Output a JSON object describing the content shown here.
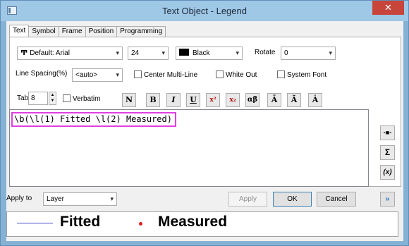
{
  "window": {
    "title": "Text Object - Legend",
    "close": "✕"
  },
  "tabs": [
    {
      "label": "Text"
    },
    {
      "label": "Symbol"
    },
    {
      "label": "Frame"
    },
    {
      "label": "Position"
    },
    {
      "label": "Programming"
    }
  ],
  "font": {
    "value": "Default: Arial",
    "glyph": "Ͳ"
  },
  "size": {
    "value": "24"
  },
  "color": {
    "value": "Black",
    "swatch": "#000000"
  },
  "rotate": {
    "label": "Rotate",
    "value": "0"
  },
  "line_spacing": {
    "label": "Line Spacing(%)",
    "value": "<auto>"
  },
  "checkboxes": {
    "center_multiline": "Center Multi-Line",
    "white_out": "White Out",
    "system_font": "System Font",
    "verbatim": "Verbatim"
  },
  "tab_field": {
    "label": "Tab",
    "value": "8"
  },
  "format_buttons": {
    "normal": "N",
    "bold": "B",
    "italic": "I",
    "underline": "U",
    "superscript": "x²",
    "subscript": "x₂",
    "greek": "αβ",
    "overbar": "Ā",
    "tilde": "Ã",
    "dot": "Ȧ"
  },
  "editor": {
    "text": "\\b(\\l(1) Fitted \\l(2) Measured)"
  },
  "side_buttons": {
    "insert_symbol": "-■-",
    "sum": "Σ",
    "variable": "(x)"
  },
  "apply_to": {
    "label": "Apply to",
    "value": "Layer"
  },
  "buttons": {
    "apply": "Apply",
    "ok": "OK",
    "cancel": "Cancel",
    "expand": "»"
  },
  "preview": {
    "item1": "Fitted",
    "item2": "Measured",
    "line_color": "#4a4acd",
    "dot_color": "#e02020"
  }
}
